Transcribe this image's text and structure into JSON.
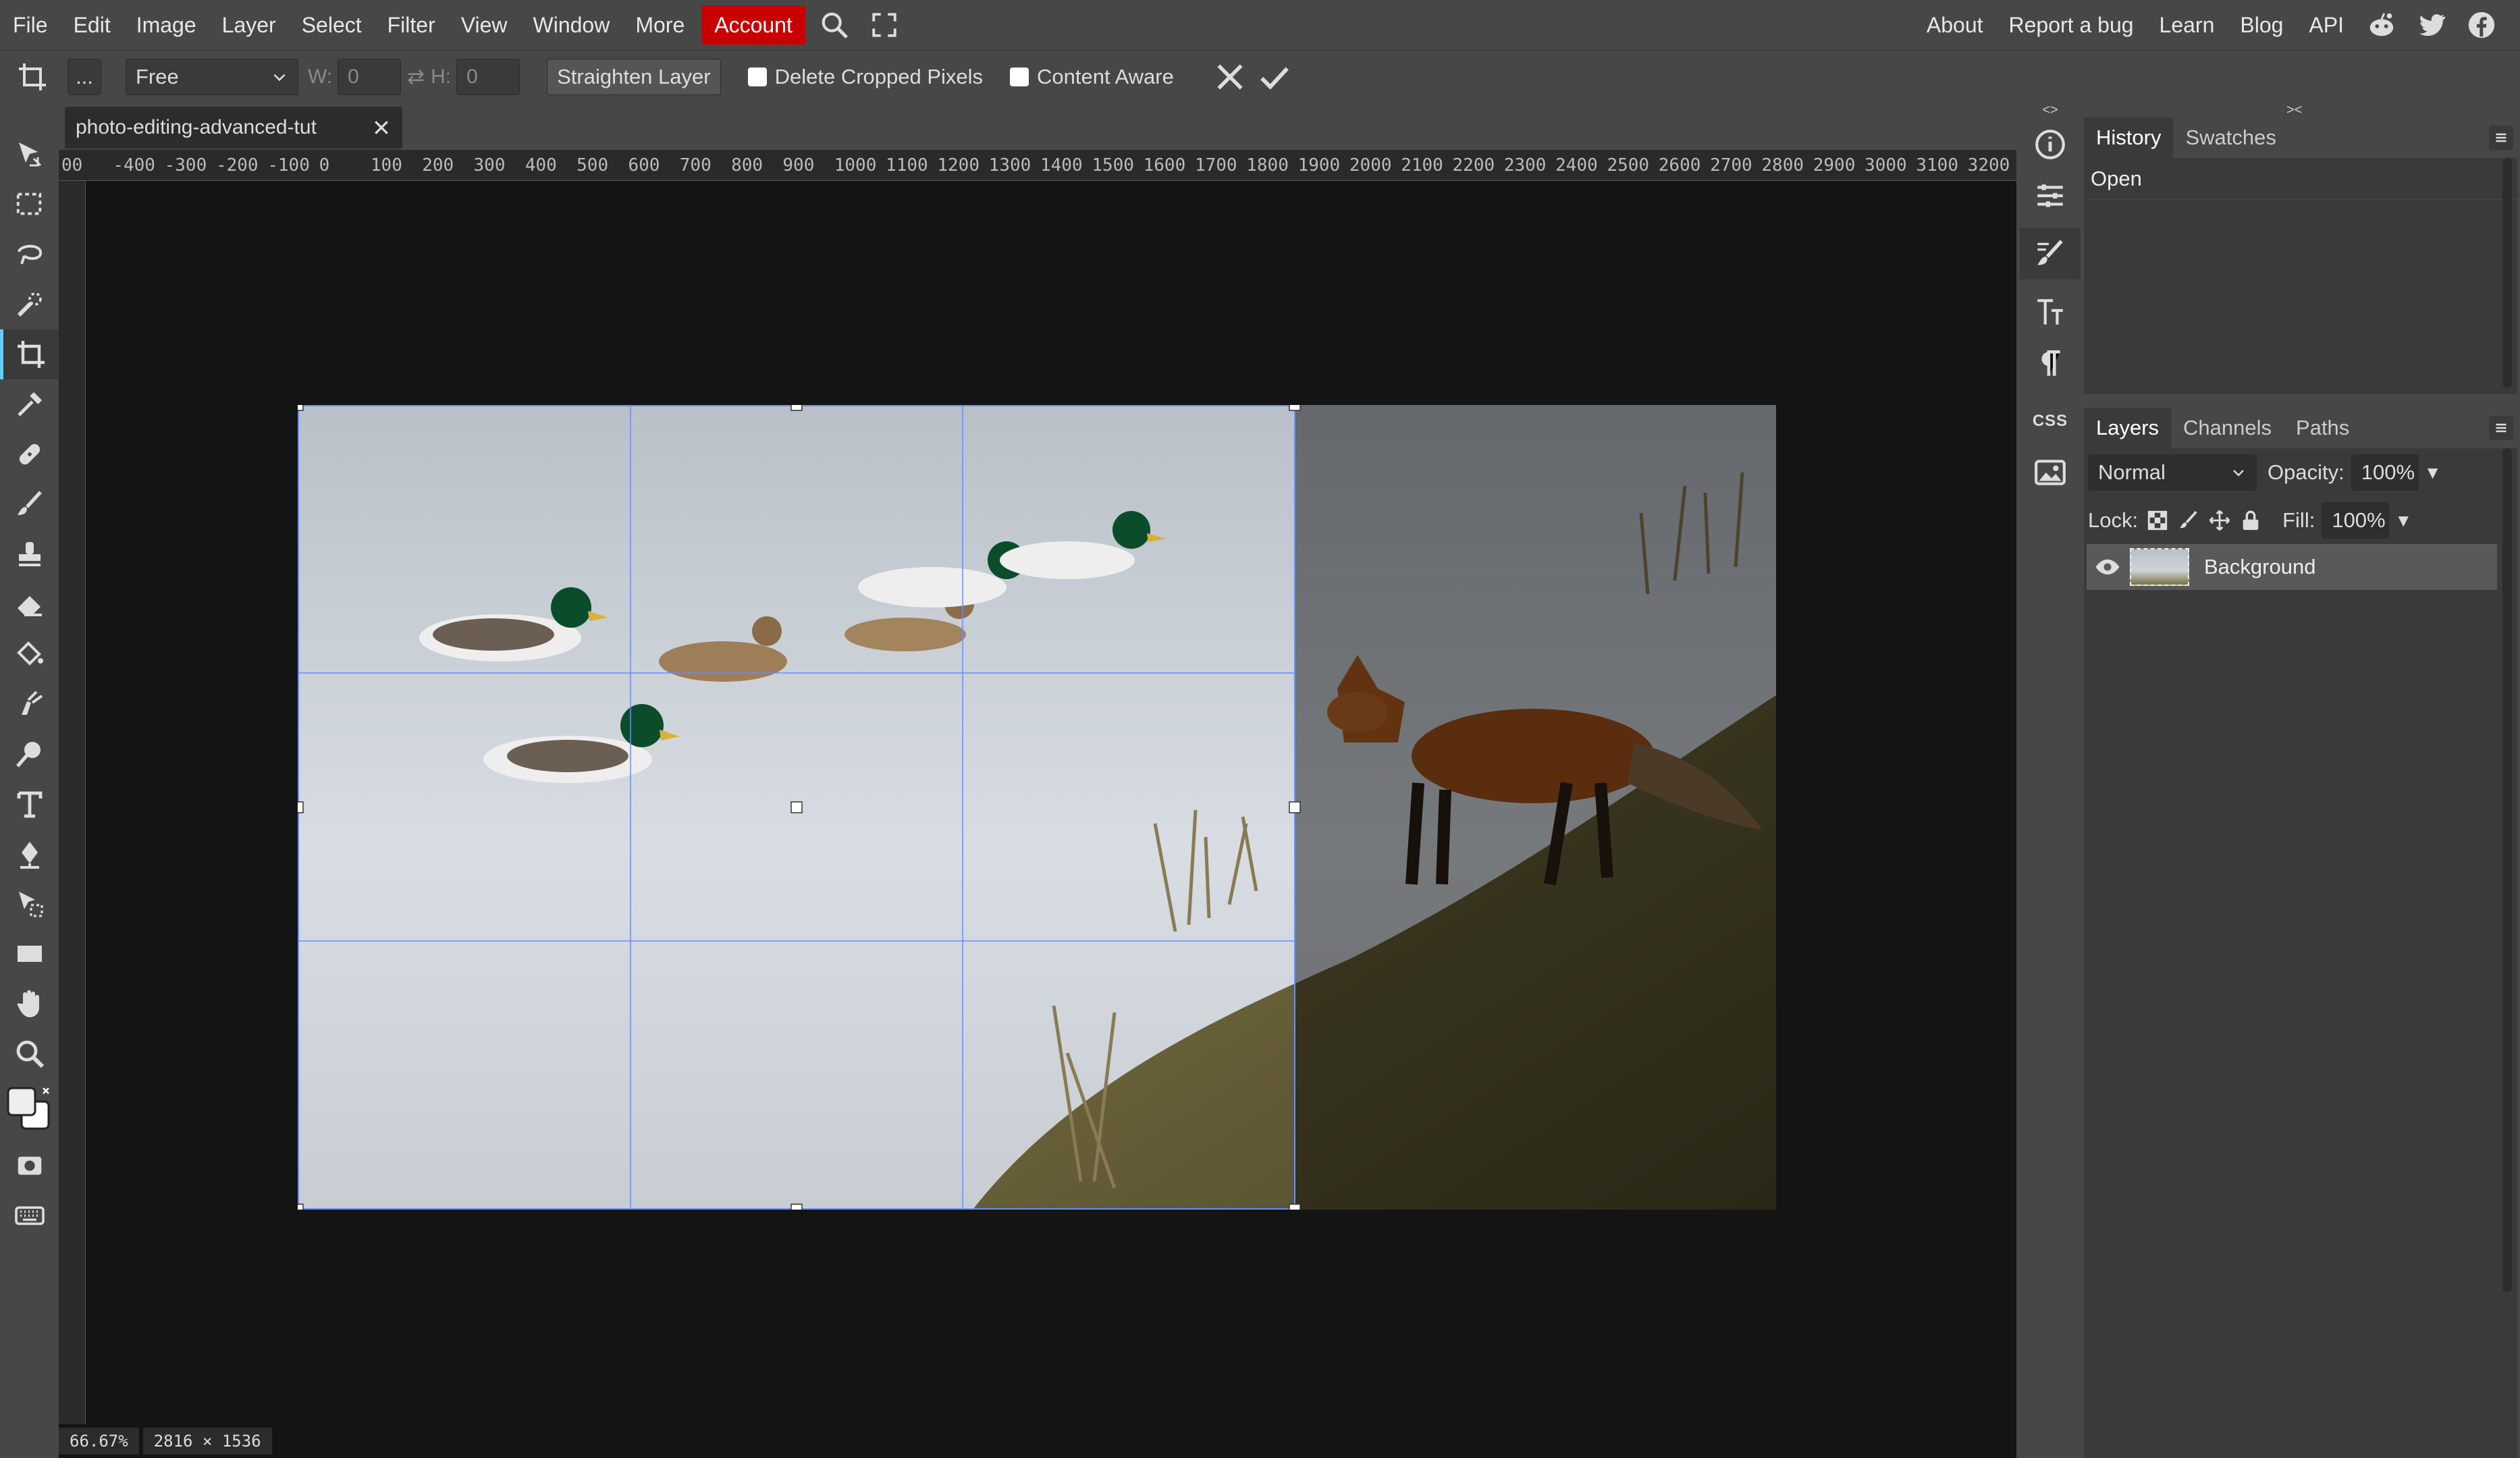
{
  "menu": {
    "items": [
      "File",
      "Edit",
      "Image",
      "Layer",
      "Select",
      "Filter",
      "View",
      "Window",
      "More",
      "Account"
    ],
    "right_links": [
      "About",
      "Report a bug",
      "Learn",
      "Blog",
      "API"
    ]
  },
  "options": {
    "more_label": "...",
    "ratio": "Free",
    "w_label": "W:",
    "w_value": "0",
    "h_label": "H:",
    "h_value": "0",
    "straighten": "Straighten Layer",
    "delete_cropped": "Delete Cropped Pixels",
    "content_aware": "Content Aware"
  },
  "document": {
    "tab_title": "photo-editing-advanced-tut",
    "ruler_labels": [
      "00",
      "-400",
      "-300",
      "-200",
      "-100",
      "0",
      "100",
      "200",
      "300",
      "400",
      "500",
      "600",
      "700",
      "800",
      "900",
      "1000",
      "1100",
      "1200",
      "1300",
      "1400",
      "1500",
      "1600",
      "1700",
      "1800",
      "1900",
      "2000",
      "2100",
      "2200",
      "2300",
      "2400",
      "2500",
      "2600",
      "2700",
      "2800",
      "2900",
      "3000",
      "3100",
      "3200"
    ],
    "zoom": "66.67%",
    "size": "2816 × 1536"
  },
  "history": {
    "tabs": [
      "History",
      "Swatches"
    ],
    "items": [
      "Open"
    ]
  },
  "layers": {
    "tabs": [
      "Layers",
      "Channels",
      "Paths"
    ],
    "blend_mode": "Normal",
    "opacity_label": "Opacity:",
    "opacity": "100%",
    "lock_label": "Lock:",
    "fill_label": "Fill:",
    "fill": "100%",
    "items": [
      {
        "name": "Background"
      }
    ]
  },
  "iconcol": {
    "css_label": "CSS"
  },
  "footer_icons": [
    "link-icon",
    "effects-icon",
    "mask-icon",
    "adjustment-icon",
    "folder-icon",
    "new-layer-icon",
    "trash-icon"
  ],
  "colors": {
    "accent": "#c80000",
    "crop_border": "#6a8cff"
  }
}
